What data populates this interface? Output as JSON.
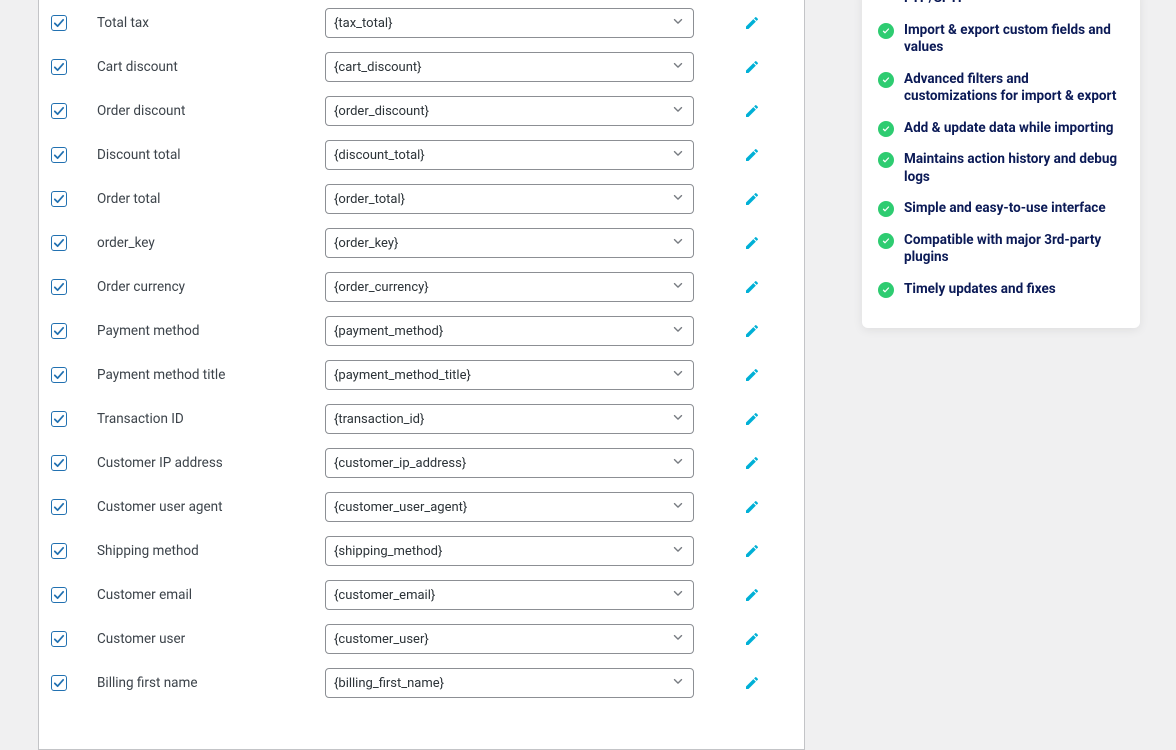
{
  "fields": [
    {
      "label": "Total tax",
      "value": "{tax_total}",
      "checked": true
    },
    {
      "label": "Cart discount",
      "value": "{cart_discount}",
      "checked": true
    },
    {
      "label": "Order discount",
      "value": "{order_discount}",
      "checked": true
    },
    {
      "label": "Discount total",
      "value": "{discount_total}",
      "checked": true
    },
    {
      "label": "Order total",
      "value": "{order_total}",
      "checked": true
    },
    {
      "label": "order_key",
      "value": "{order_key}",
      "checked": true
    },
    {
      "label": "Order currency",
      "value": "{order_currency}",
      "checked": true
    },
    {
      "label": "Payment method",
      "value": "{payment_method}",
      "checked": true
    },
    {
      "label": "Payment method title",
      "value": "{payment_method_title}",
      "checked": true
    },
    {
      "label": "Transaction ID",
      "value": "{transaction_id}",
      "checked": true
    },
    {
      "label": "Customer IP address",
      "value": "{customer_ip_address}",
      "checked": true
    },
    {
      "label": "Customer user agent",
      "value": "{customer_user_agent}",
      "checked": true
    },
    {
      "label": "Shipping method",
      "value": "{shipping_method}",
      "checked": true
    },
    {
      "label": "Customer email",
      "value": "{customer_email}",
      "checked": true
    },
    {
      "label": "Customer user",
      "value": "{customer_user}",
      "checked": true
    },
    {
      "label": "Billing first name",
      "value": "{billing_first_name}",
      "checked": true
    }
  ],
  "sidebar": {
    "partial_top": "FTP/SFTP",
    "features": [
      "Import & export custom fields and values",
      "Advanced filters and customizations for import & export",
      "Add & update data while importing",
      "Maintains action history and debug logs",
      "Simple and easy-to-use interface",
      "Compatible with major 3rd-party plugins",
      "Timely updates and fixes"
    ]
  },
  "colors": {
    "checkbox_border": "#2271b1",
    "check_mark": "#2271b1",
    "edit_icon": "#00b0d6",
    "feature_check_bg": "#2ecc71",
    "feature_text": "#0b1a56"
  }
}
